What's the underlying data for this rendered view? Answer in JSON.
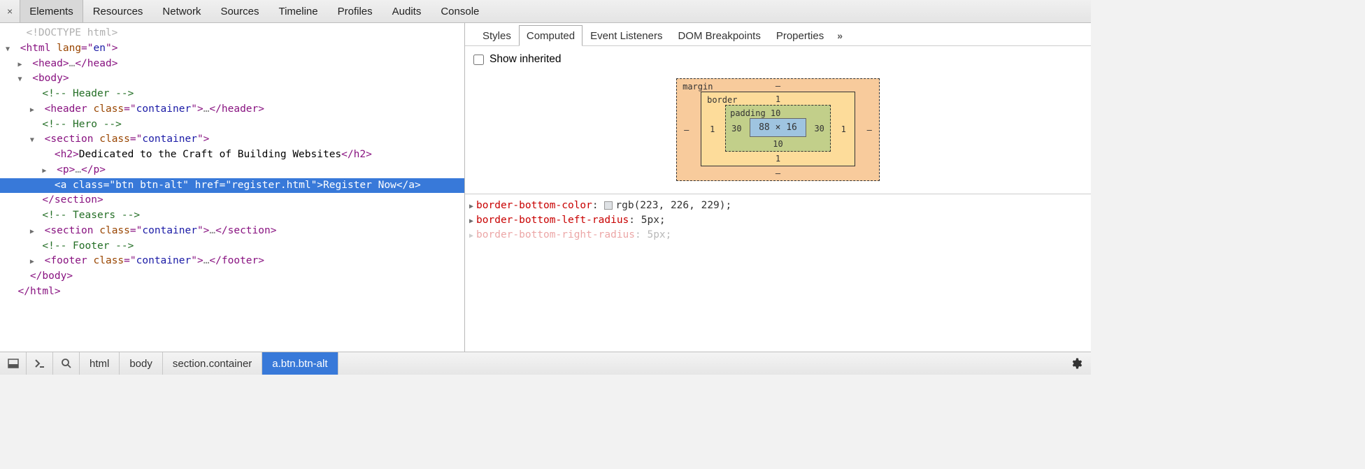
{
  "toolbar": {
    "tabs": [
      "Elements",
      "Resources",
      "Network",
      "Sources",
      "Timeline",
      "Profiles",
      "Audits",
      "Console"
    ],
    "active": "Elements"
  },
  "dom": {
    "doctype": "<!DOCTYPE html>",
    "html_open": "<html lang=\"en\">",
    "head": "<head>…</head>",
    "body_open": "<body>",
    "c_header": "<!-- Header -->",
    "header_el": "<header class=\"container\">…</header>",
    "c_hero": "<!-- Hero -->",
    "section_open": "<section class=\"container\">",
    "h2_open": "<h2>",
    "h2_text": "Dedicated to the Craft of Building Websites",
    "h2_close": "</h2>",
    "p_el": "<p>…</p>",
    "a_raw": "<a class=\"btn btn-alt\" href=\"register.html\">Register Now</a>",
    "section_close": "</section>",
    "c_teasers": "<!-- Teasers -->",
    "section2": "<section class=\"container\">…</section>",
    "c_footer": "<!-- Footer -->",
    "footer_el": "<footer class=\"container\">…</footer>",
    "body_close": "</body>",
    "html_close": "</html>"
  },
  "side": {
    "tabs": [
      "Styles",
      "Computed",
      "Event Listeners",
      "DOM Breakpoints",
      "Properties"
    ],
    "active": "Computed",
    "show_inherited_label": "Show inherited"
  },
  "boxmodel": {
    "margin": {
      "label": "margin",
      "top": "–",
      "right": "–",
      "bottom": "–",
      "left": "–"
    },
    "border": {
      "label": "border",
      "top": "1",
      "right": "1",
      "bottom": "1",
      "left": "1"
    },
    "padding": {
      "label": "padding",
      "top": "10",
      "right": "30",
      "bottom": "10",
      "left": "30"
    },
    "content": "88 × 16"
  },
  "props": [
    {
      "name": "border-bottom-color",
      "value": "rgb(223, 226, 229)",
      "swatch": "#dfe2e5"
    },
    {
      "name": "border-bottom-left-radius",
      "value": "5px"
    },
    {
      "name": "border-bottom-right-radius",
      "value": "5px"
    }
  ],
  "breadcrumb": [
    "html",
    "body",
    "section.container",
    "a.btn.btn-alt"
  ],
  "breadcrumb_active": "a.btn.btn-alt"
}
